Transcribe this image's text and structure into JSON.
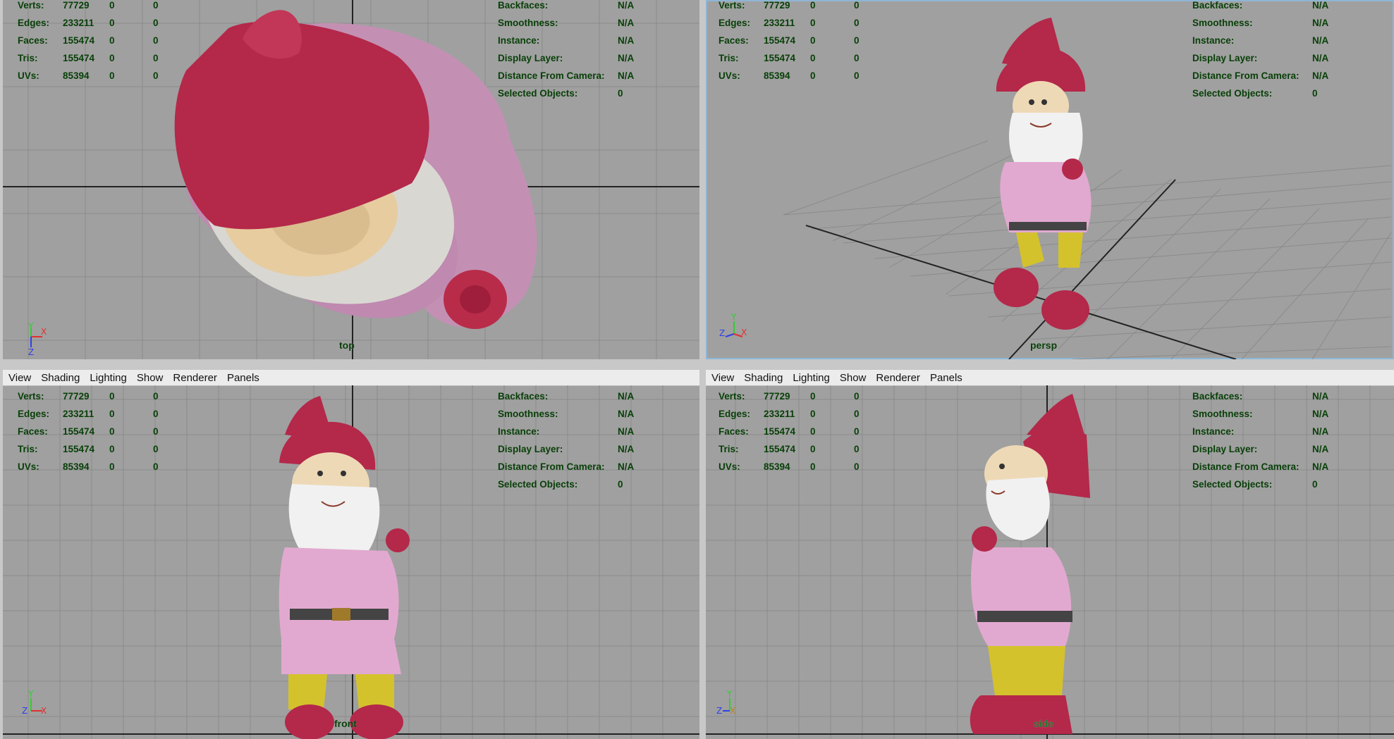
{
  "menu": [
    "View",
    "Shading",
    "Lighting",
    "Show",
    "Renderer",
    "Panels"
  ],
  "stats": [
    {
      "label": "Verts:",
      "value": "77729",
      "sel": "0",
      "comp": "0"
    },
    {
      "label": "Edges:",
      "value": "233211",
      "sel": "0",
      "comp": "0"
    },
    {
      "label": "Faces:",
      "value": "155474",
      "sel": "0",
      "comp": "0"
    },
    {
      "label": "Tris:",
      "value": "155474",
      "sel": "0",
      "comp": "0"
    },
    {
      "label": "UVs:",
      "value": "85394",
      "sel": "0",
      "comp": "0"
    }
  ],
  "info": [
    {
      "label": "Backfaces:",
      "value": "N/A"
    },
    {
      "label": "Smoothness:",
      "value": "N/A"
    },
    {
      "label": "Instance:",
      "value": "N/A"
    },
    {
      "label": "Display Layer:",
      "value": "N/A"
    },
    {
      "label": "Distance From Camera:",
      "value": "N/A"
    },
    {
      "label": "Selected Objects:",
      "value": "0"
    }
  ],
  "viewports": [
    {
      "name": "top",
      "label": "top",
      "axes": [
        "Y",
        "X",
        "Z"
      ]
    },
    {
      "name": "persp",
      "label": "persp",
      "axes": [
        "Y",
        "Z",
        "X"
      ]
    },
    {
      "name": "front",
      "label": "front",
      "axes": [
        "Y",
        "Z",
        "X"
      ]
    },
    {
      "name": "side",
      "label": "side",
      "axes": [
        "Y",
        "Z",
        "X"
      ]
    }
  ],
  "colors": {
    "viewport_bg": "#a0a0a0",
    "grid": "#8a8a8a",
    "hud_text": "#073f07",
    "hat": "#b3294a",
    "shirt": "#e2a9d0",
    "pants": "#d4c22c",
    "beard": "#f1f1f1",
    "skin": "#e9cfa6",
    "axis_x": "#e23030",
    "axis_y": "#2fcf2f",
    "axis_z": "#3040e8"
  }
}
